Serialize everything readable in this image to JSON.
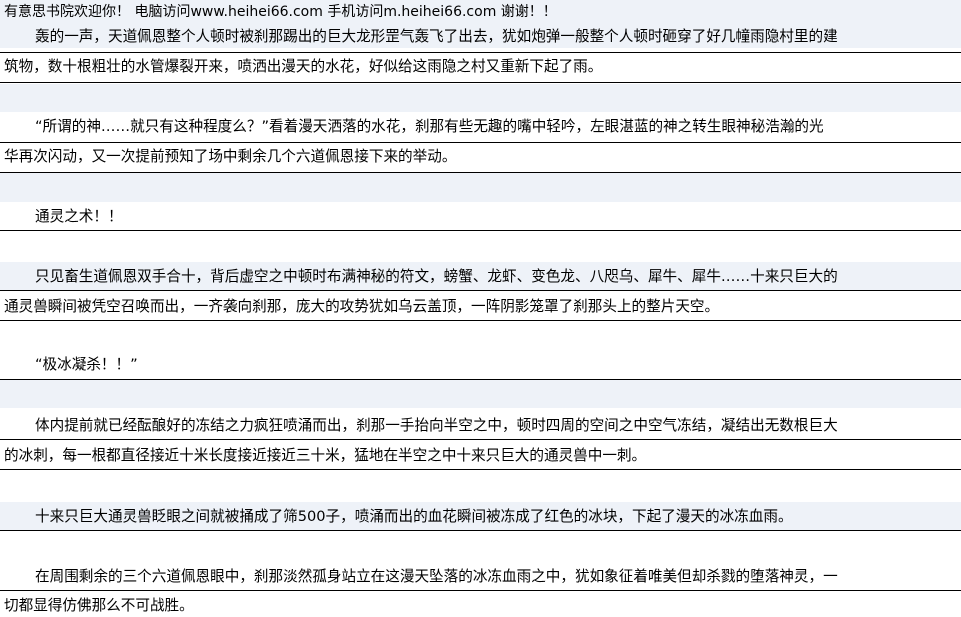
{
  "header": {
    "text": "有意思书院欢迎你！ 电脑访问www.heihei66.com  手机访问m.heihei66.com 谢谢！！"
  },
  "paragraphs": [
    {
      "lines": [
        "轰的一声，天道佩恩整个人顿时被刹那踢出的巨大龙形罡气轰飞了出去，犹如炮弹一般整个人顿时砸穿了好几幢雨隐村里的建",
        "筑物，数十根粗壮的水管爆裂开来，喷洒出漫天的水花，好似给这雨隐之村又重新下起了雨。"
      ]
    },
    {
      "lines": [
        "“所谓的神……就只有这种程度么？”看着漫天洒落的水花，刹那有些无趣的嘴中轻吟，左眼湛蓝的神之转生眼神秘浩瀚的光",
        "华再次闪动，又一次提前预知了场中剩余几个六道佩恩接下来的举动。"
      ]
    },
    {
      "lines": [
        "通灵之术！！"
      ]
    },
    {
      "lines": [
        "只见畜生道佩恩双手合十，背后虚空之中顿时布满神秘的符文，螃蟹、龙虾、变色龙、八咫乌、犀牛、犀牛……十来只巨大的",
        "通灵兽瞬间被凭空召唤而出，一齐袭向刹那，庞大的攻势犹如乌云盖顶，一阵阴影笼罩了刹那头上的整片天空。"
      ]
    },
    {
      "lines": [
        "“极冰凝杀！！”"
      ]
    },
    {
      "lines": [
        "体内提前就已经酝酿好的冻结之力疯狂喷涌而出，刹那一手抬向半空之中，顿时四周的空间之中空气冻结，凝结出无数根巨大",
        "的冰刺，每一根都直径接近十米长度接近接近三十米，猛地在半空之中十来只巨大的通灵兽中一刺。"
      ]
    },
    {
      "lines": [
        "十来只巨大通灵兽眨眼之间就被捅成了筛500子，喷涌而出的血花瞬间被冻成了红色的冰块，下起了漫天的冰冻血雨。"
      ]
    },
    {
      "lines": [
        "在周围剩余的三个六道佩恩眼中，刹那淡然孤身站立在这漫天坠落的冰冻血雨之中，犹如象征着唯美但却杀戮的堕落神灵，一",
        "切都显得仿佛那么不可战胜。"
      ]
    }
  ]
}
